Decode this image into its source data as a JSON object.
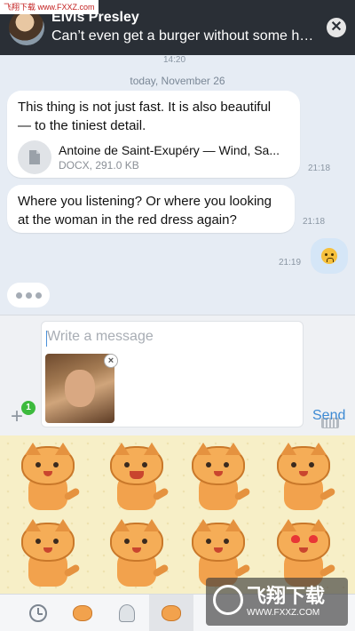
{
  "watermark_top": "飞翔下载 www.FXXZ.com",
  "notification": {
    "sender": "Elvis Presley",
    "message": "Can’t even get a burger without some hea...",
    "close_symbol": "✕"
  },
  "chat": {
    "faint_time": "14:20",
    "date_separator": "today, November 26",
    "messages": [
      {
        "text": "This thing is not just fast. It is also beautiful — to the tiniest detail.",
        "attachment": {
          "name": "Antoine de Saint-Exupéry — Wind, Sa...",
          "meta": "DOCX, 291.0 KB"
        },
        "time": "21:18"
      },
      {
        "text": "Where you listening? Or where you looking at the woman in the red dress again?",
        "time": "21:18"
      },
      {
        "emoji": "worried-face",
        "time": "21:19"
      }
    ]
  },
  "composer": {
    "placeholder": "Write a message",
    "attach_badge": "1",
    "send_label": "Send",
    "attach_symbol": "+"
  },
  "stickers": [
    "cat-tongue",
    "cat-laughing",
    "cat-thumbs-up",
    "cat-smirk",
    "cat-wink",
    "cat-wink-finger",
    "cat-kiss",
    "cat-heart-eyes"
  ],
  "tabs": [
    "recent",
    "cat-pack",
    "ghost-pack",
    "cat-pack-active"
  ],
  "watermark_bottom": {
    "title": "飞翔下载",
    "url": "WWW.FXXZ.COM"
  }
}
